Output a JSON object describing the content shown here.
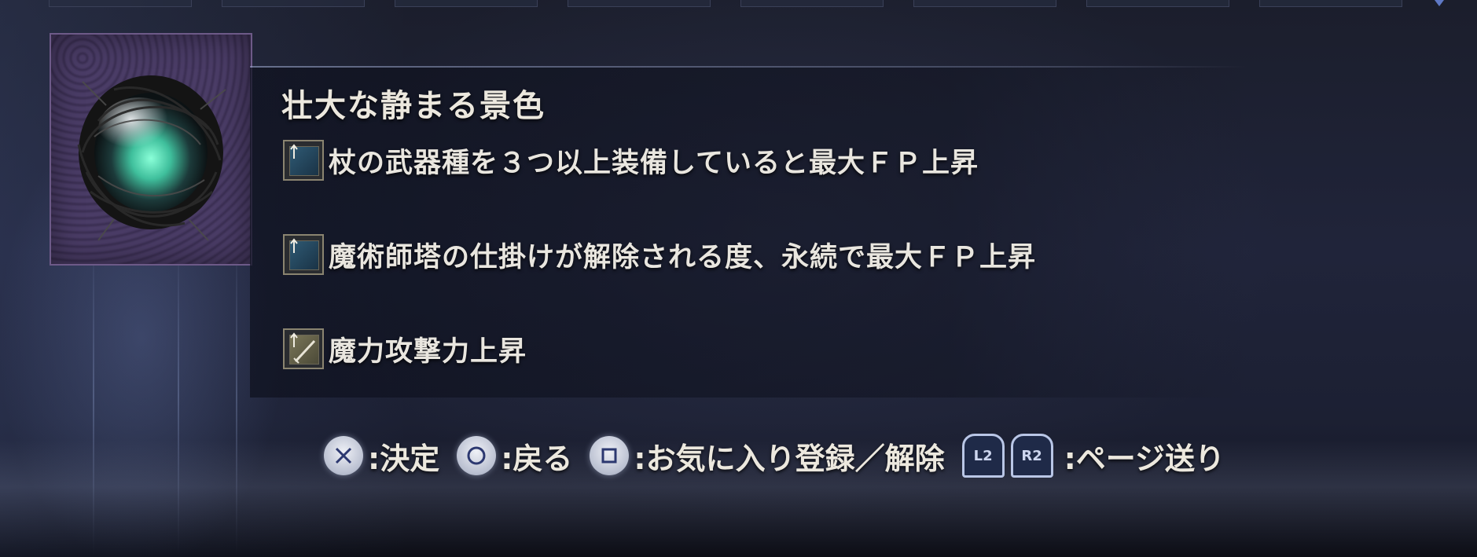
{
  "item": {
    "name": "壮大な静まる景色",
    "icon": "sorcery-orb-icon"
  },
  "effects": [
    {
      "icon": "fp-up-icon",
      "text": "杖の武器種を３つ以上装備していると最大ＦＰ上昇"
    },
    {
      "icon": "fp-up-icon",
      "text": "魔術師塔の仕掛けが解除される度、永続で最大ＦＰ上昇"
    },
    {
      "icon": "attack-up-icon",
      "text": "魔力攻撃力上昇"
    }
  ],
  "controls": {
    "confirm": {
      "button": "cross",
      "label": ":決定"
    },
    "back": {
      "button": "circle",
      "label": ":戻る"
    },
    "favorite": {
      "button": "square",
      "label": ":お気に入り登録／解除"
    },
    "page": {
      "l_button": "L2",
      "r_button": "R2",
      "label": ":ページ送り"
    }
  },
  "colors": {
    "item_frame": "#6d5a88",
    "text": "#e9e6df",
    "trigger_border": "#b9c6e6"
  }
}
